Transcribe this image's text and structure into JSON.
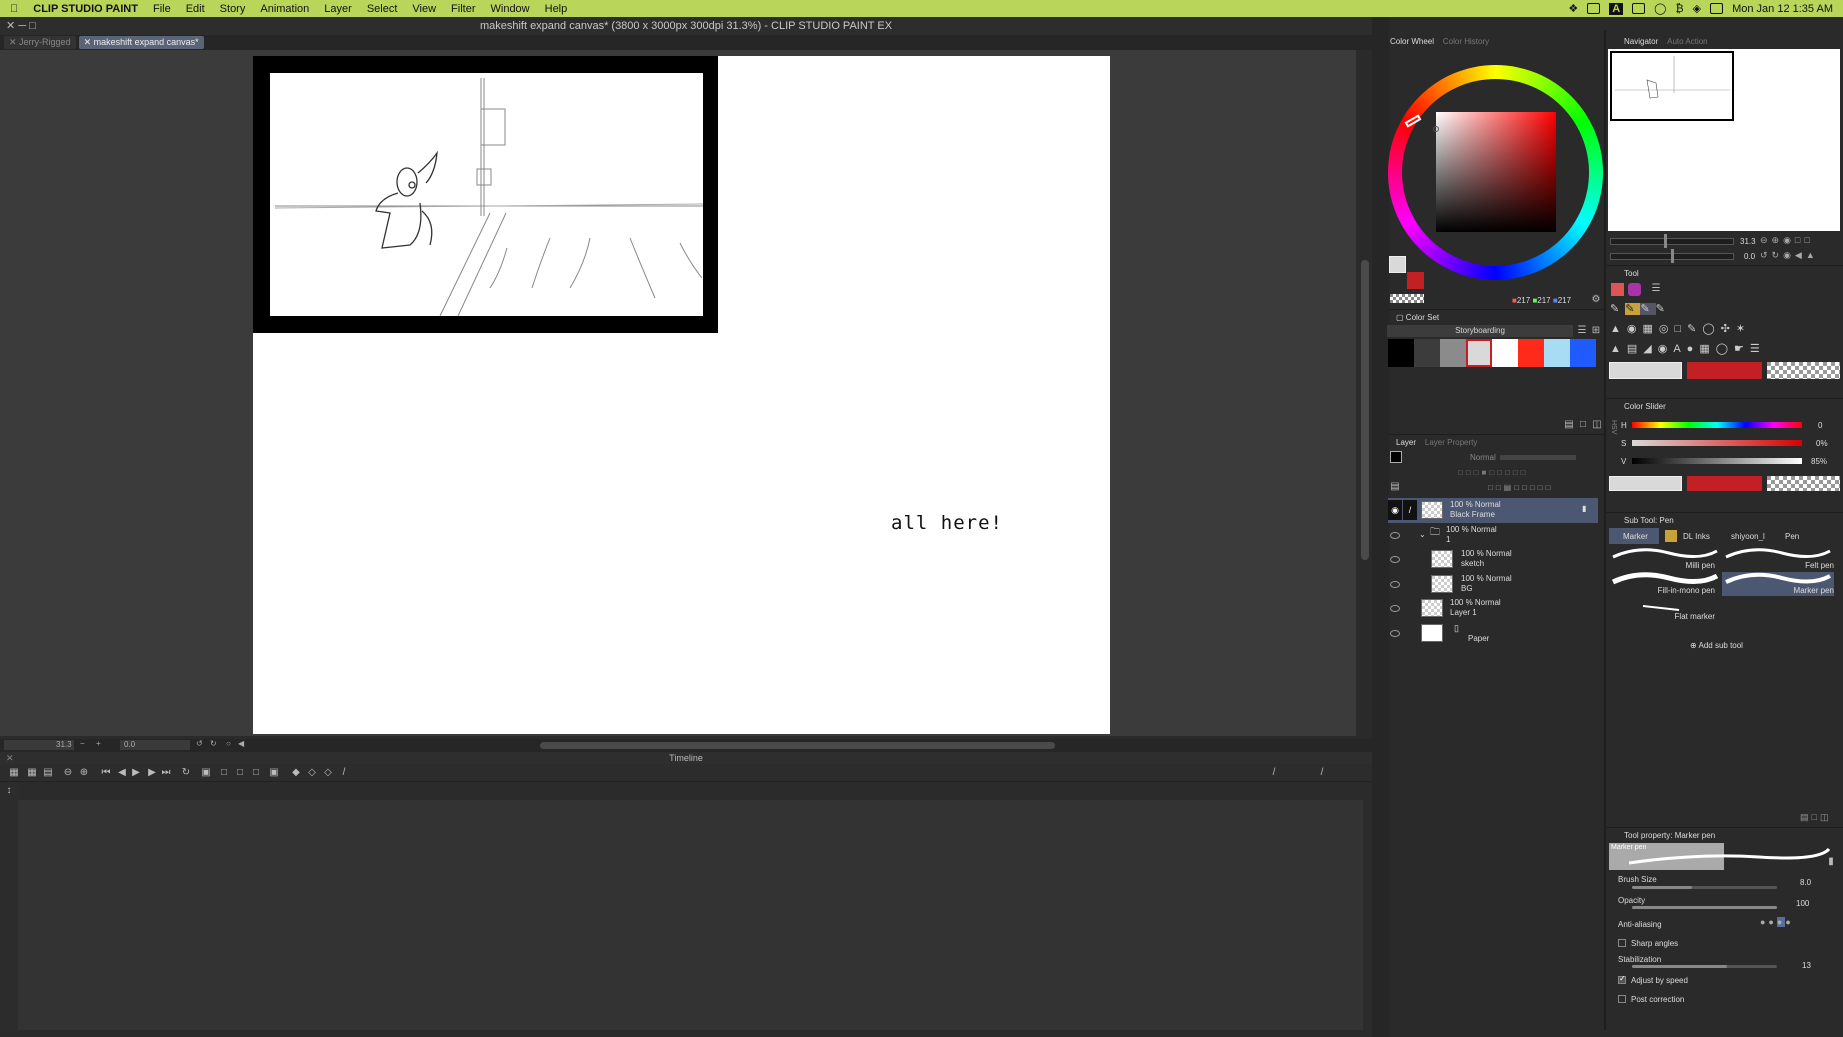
{
  "menubar": {
    "app_name": "CLIP STUDIO PAINT",
    "items": [
      "File",
      "Edit",
      "Story",
      "Animation",
      "Layer",
      "Select",
      "View",
      "Filter",
      "Window",
      "Help"
    ],
    "clock": "Mon Jan 12  1:35 AM"
  },
  "window": {
    "title": "makeshift expand canvas* (3800 x 3000px 300dpi 31.3%)  - CLIP STUDIO PAINT EX"
  },
  "tabs": [
    {
      "label": "Jerry-Rigged"
    },
    {
      "label": "makeshift expand canvas*"
    }
  ],
  "canvas": {
    "handwritten_text": "all here!"
  },
  "statusbar": {
    "zoom": "31.3",
    "rotation": "0.0"
  },
  "timeline": {
    "title": "Timeline"
  },
  "color_wheel": {
    "tab_active": "Color Wheel",
    "tab_inactive": "Color History",
    "rgb": {
      "r": "217",
      "g": "217",
      "b": "217"
    }
  },
  "color_set": {
    "title": "Color Set",
    "set_name": "Storyboarding",
    "swatches": [
      "#000000",
      "#3c3c3c",
      "#8b8b8b",
      "#d9d9d9",
      "#ffffff",
      "#ff2a1a",
      "#a8dcf5",
      "#1f5bff"
    ]
  },
  "layer": {
    "tab_active": "Layer",
    "tab_inactive": "Layer Property",
    "blend_mode": "Normal",
    "rows": [
      {
        "pct": "100 % Normal",
        "name": "Black Frame"
      },
      {
        "pct": "100 % Normal",
        "name": "1"
      },
      {
        "pct": "100 % Normal",
        "name": "sketch"
      },
      {
        "pct": "100 % Normal",
        "name": "BG"
      },
      {
        "pct": "100 % Normal",
        "name": "Layer 1"
      },
      {
        "pct": "",
        "name": "Paper"
      }
    ]
  },
  "navigator": {
    "tab_active": "Navigator",
    "tab_inactive": "Auto Action",
    "zoom": "31.3",
    "rotation": "0.0"
  },
  "tool": {
    "title": "Tool"
  },
  "color_slider": {
    "title": "Color Slider",
    "h_label": "H",
    "s_label": "S",
    "v_label": "V",
    "h_value": "0",
    "s_value": "0%",
    "v_value": "85%",
    "mode": "HSV"
  },
  "sub_tool": {
    "title": "Sub Tool: Pen",
    "tabs": [
      "Marker",
      "DL Inks",
      "shiyoon_l",
      "Pen"
    ],
    "items": [
      "Milli pen",
      "Felt pen",
      "Fill-in-mono pen",
      "Marker pen",
      "Flat marker"
    ],
    "add_label": "Add sub tool"
  },
  "tool_property": {
    "title": "Tool property: Marker pen",
    "preview_label": "Marker pen",
    "brush_size_label": "Brush Size",
    "brush_size": "8.0",
    "opacity_label": "Opacity",
    "opacity": "100",
    "anti_alias_label": "Anti-aliasing",
    "sharp_angles_label": "Sharp angles",
    "stabilization_label": "Stabilization",
    "stabilization": "13",
    "adjust_speed_label": "Adjust by speed",
    "post_correction_label": "Post correction"
  },
  "accent": {
    "main_color": "#c32026",
    "selection": "#4c5872"
  }
}
